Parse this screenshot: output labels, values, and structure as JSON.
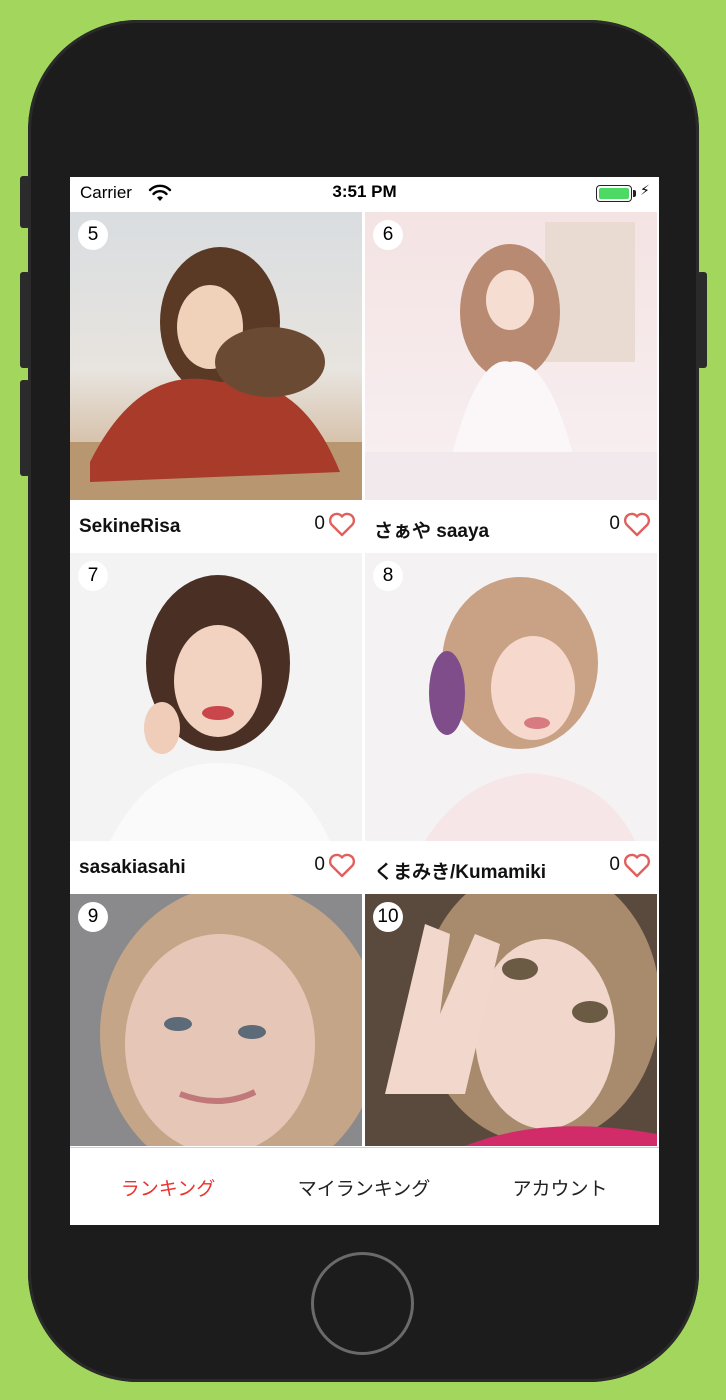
{
  "status_bar": {
    "carrier": "Carrier",
    "time": "3:51 PM"
  },
  "cards": [
    {
      "rank": "5",
      "name": "SekineRisa",
      "likes": "0"
    },
    {
      "rank": "6",
      "name": "さぁや saaya",
      "likes": "0"
    },
    {
      "rank": "7",
      "name": "sasakiasahi",
      "likes": "0"
    },
    {
      "rank": "8",
      "name": "くまみき/Kumamiki",
      "likes": "0"
    },
    {
      "rank": "9",
      "name": "",
      "likes": ""
    },
    {
      "rank": "10",
      "name": "",
      "likes": ""
    }
  ],
  "tabs": [
    {
      "label": "ランキング",
      "active": true
    },
    {
      "label": "マイランキング",
      "active": false
    },
    {
      "label": "アカウント",
      "active": false
    }
  ],
  "colors": {
    "accent": "#e8332f",
    "heart": "#e0605e",
    "background": "#a3d65c"
  },
  "icons": {
    "heart": "heart-outline-icon",
    "wifi": "wifi-icon",
    "battery": "battery-charging-icon"
  }
}
